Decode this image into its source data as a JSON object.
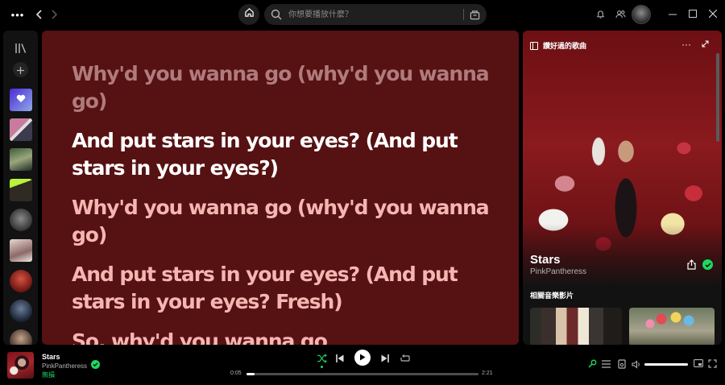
{
  "topbar": {
    "search_placeholder": "你想要播放什麼？"
  },
  "lyrics": {
    "lines": [
      {
        "text": "Why'd you wanna go (why'd you wanna go)",
        "state": "past"
      },
      {
        "text": "And put stars in your eyes? (And put stars in your eyes?)",
        "state": "current"
      },
      {
        "text": "Why'd you wanna go (why'd you wanna go)",
        "state": "future"
      },
      {
        "text": "And put stars in your eyes? (And put stars in your eyes? Fresh)",
        "state": "future"
      },
      {
        "text": "So, why'd you wanna go",
        "state": "future"
      }
    ]
  },
  "now_playing_panel": {
    "header": "讚好過的歌曲",
    "title": "Stars",
    "artist": "PinkPantheress",
    "section_title": "相關音樂影片"
  },
  "player": {
    "title": "Stars",
    "artist": "PinkPantheress",
    "subtitle": "無損",
    "time_current": "0:05",
    "time_total": "2:21",
    "progress_fraction": 0.035,
    "volume_fraction": 1.0
  },
  "colors": {
    "accent": "#1ed760",
    "lyrics_bg": "#561112",
    "lyric_past": "#b07b7c",
    "lyric_current": "#ffffff",
    "lyric_future": "#f5b6b2"
  },
  "icons": {
    "menu": "more-horizontal-icon",
    "back": "chevron-left-icon",
    "forward": "chevron-right-icon",
    "home": "home-icon",
    "search": "search-icon",
    "browse": "browse-icon",
    "notifications": "bell-icon",
    "friends": "friends-icon",
    "library": "library-icon",
    "add": "plus-icon",
    "liked": "heart-icon",
    "shuffle": "shuffle-icon",
    "previous": "skip-back-icon",
    "play": "play-icon",
    "next": "skip-forward-icon",
    "repeat": "repeat-icon",
    "lyrics": "microphone-icon",
    "queue": "queue-icon",
    "device": "device-icon",
    "volume": "volume-icon",
    "miniplayer": "miniplayer-icon",
    "fullscreen": "fullscreen-icon"
  }
}
